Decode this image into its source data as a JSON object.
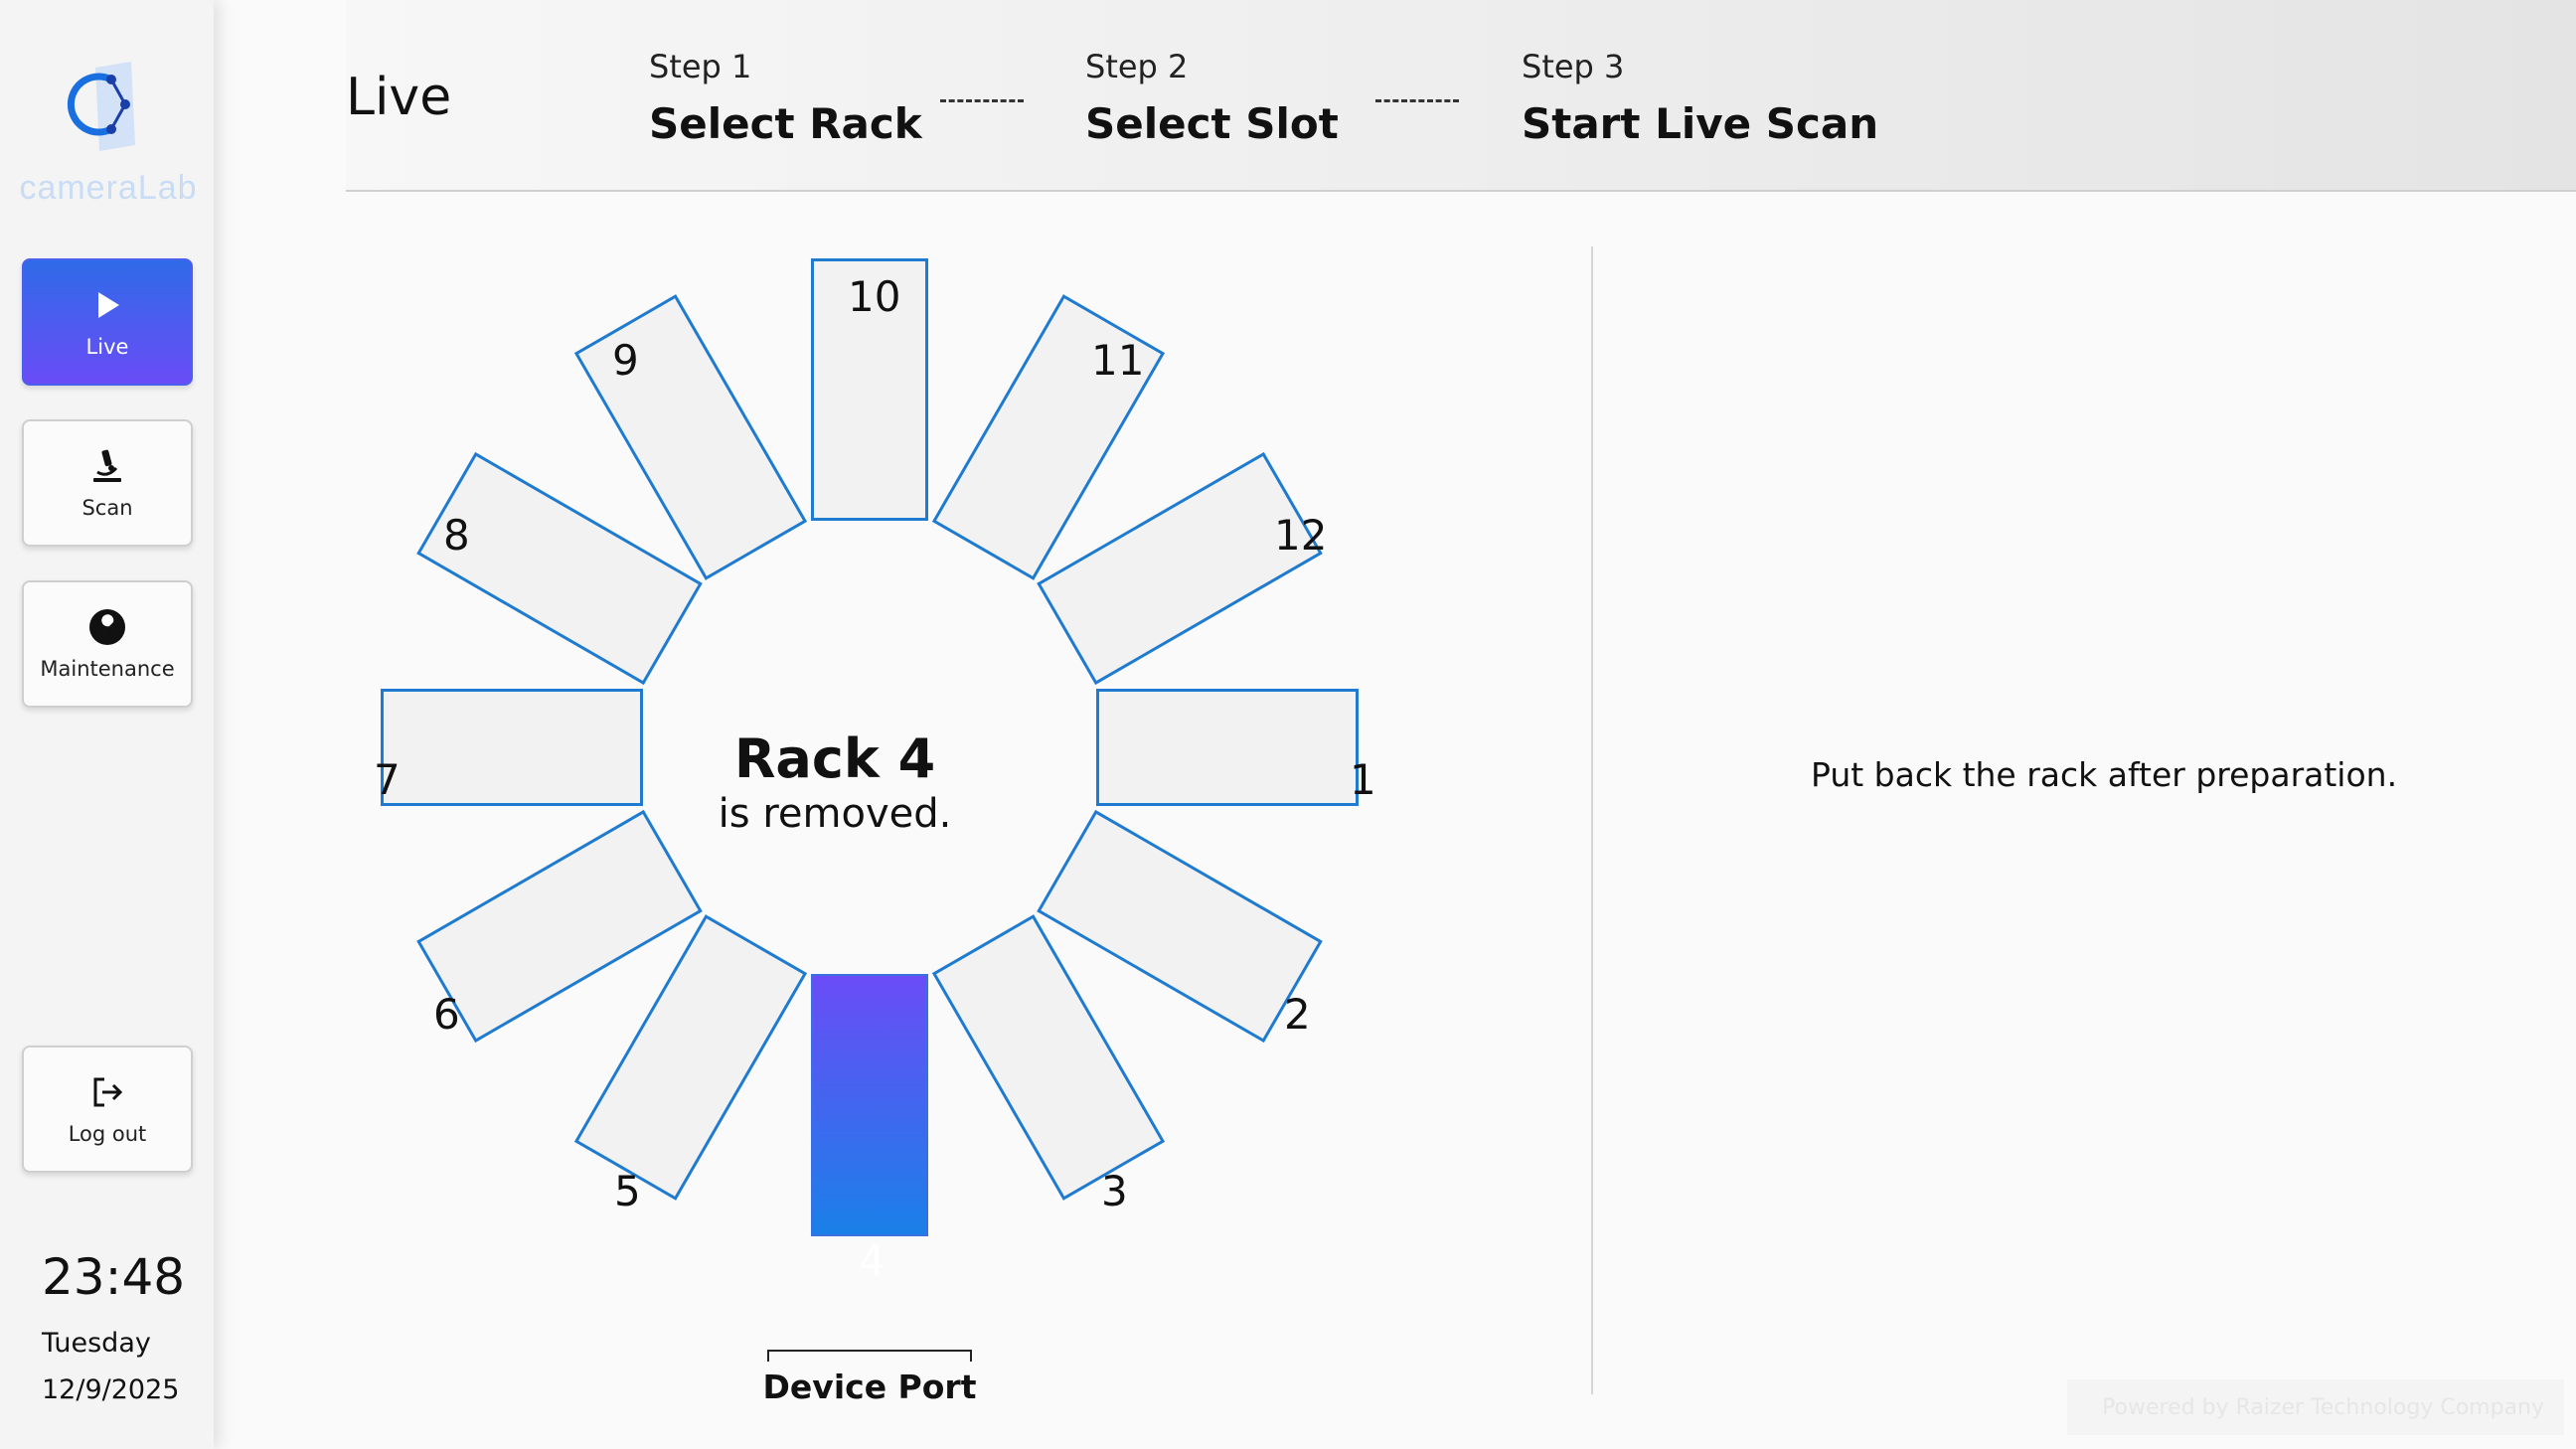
{
  "sidebar": {
    "logo_text": "cameraLab",
    "nav": [
      {
        "label": "Live",
        "icon": "play-icon",
        "active": true
      },
      {
        "label": "Scan",
        "icon": "microscope-icon",
        "active": false
      },
      {
        "label": "Maintenance",
        "icon": "wrench-icon",
        "active": false
      }
    ],
    "logout_label": "Log out",
    "clock": {
      "time": "23:48",
      "day": "Tuesday",
      "date": "12/9/2025"
    }
  },
  "header": {
    "title": "Live",
    "steps": [
      {
        "num": "Step 1",
        "name": "Select Rack"
      },
      {
        "num": "Step 2",
        "name": "Select Slot"
      },
      {
        "num": "Step 3",
        "name": "Start Live Scan"
      }
    ]
  },
  "rack": {
    "slots": [
      "1",
      "2",
      "3",
      "4",
      "5",
      "6",
      "7",
      "8",
      "9",
      "10",
      "11",
      "12"
    ],
    "active_slot": "4",
    "status_title": "Rack 4",
    "status_sub": "is removed.",
    "device_port_label": "Device Port"
  },
  "instruction": "Put back the rack after preparation.",
  "footer_note": "Powered by Raizer Technology Company",
  "colors": {
    "accent_blue": "#1e7bd0",
    "active_gradient_top": "#6a4cf6",
    "active_gradient_bottom": "#1a80e8"
  }
}
